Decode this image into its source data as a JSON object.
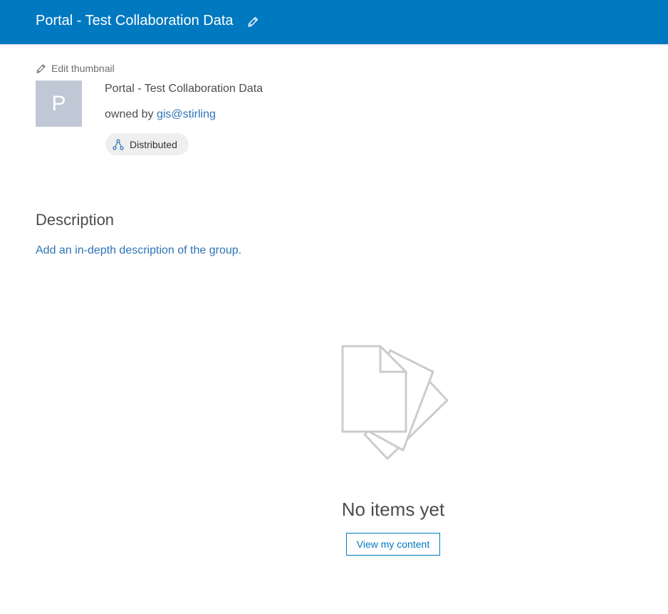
{
  "header": {
    "title": "Portal - Test Collaboration Data",
    "edit_icon": "pencil-icon",
    "background": "#0079c1"
  },
  "thumbnail": {
    "edit_label": "Edit thumbnail",
    "letter": "P",
    "background": "#c0c8d6"
  },
  "group": {
    "name": "Portal - Test Collaboration Data",
    "owned_by_prefix": "owned by ",
    "owner": "gis@stirling",
    "badge_label": "Distributed",
    "badge_icon": "distributed-icon"
  },
  "description": {
    "heading": "Description",
    "add_link": "Add an in-depth description of the group."
  },
  "empty_state": {
    "illustration": "documents-icon",
    "title": "No items yet",
    "button_label": "View my content"
  },
  "colors": {
    "link": "#2e74b5",
    "accent": "#0079c1"
  }
}
